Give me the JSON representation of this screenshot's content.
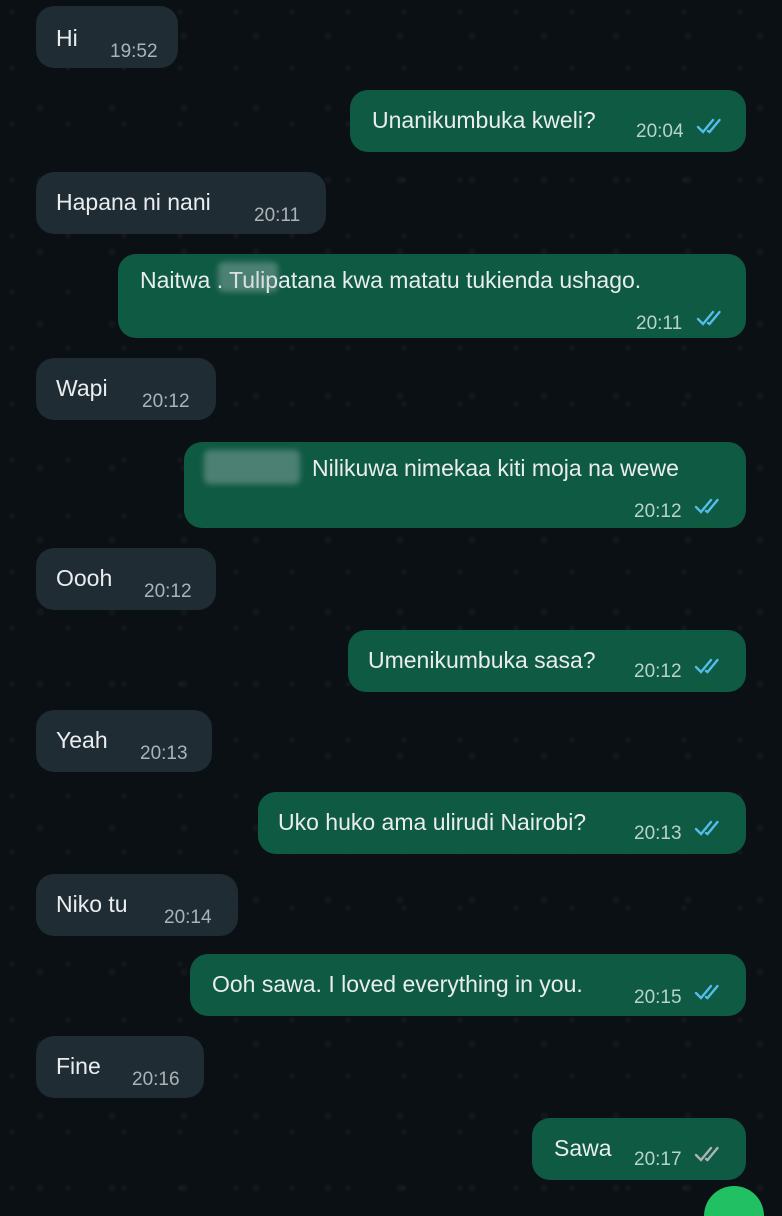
{
  "messages": [
    {
      "dir": "in",
      "text": "Hi",
      "time": "19:52"
    },
    {
      "dir": "out",
      "text": "Unanikumbuka kweli?",
      "time": "20:04",
      "status": "read"
    },
    {
      "dir": "in",
      "text": "Hapana ni nani",
      "time": "20:11"
    },
    {
      "dir": "out",
      "text": "Naitwa      . Tulipatana kwa matatu tukienda ushago.",
      "time": "20:11",
      "status": "read"
    },
    {
      "dir": "in",
      "text": "Wapi",
      "time": "20:12"
    },
    {
      "dir": "out",
      "text": "Nilikuwa nimekaa kiti moja na wewe",
      "time": "20:12",
      "status": "read"
    },
    {
      "dir": "in",
      "text": "Oooh",
      "time": "20:12"
    },
    {
      "dir": "out",
      "text": "Umenikumbuka sasa?",
      "time": "20:12",
      "status": "read"
    },
    {
      "dir": "in",
      "text": "Yeah",
      "time": "20:13"
    },
    {
      "dir": "out",
      "text": "Uko huko ama ulirudi Nairobi?",
      "time": "20:13",
      "status": "read"
    },
    {
      "dir": "in",
      "text": "Niko tu",
      "time": "20:14"
    },
    {
      "dir": "out",
      "text": "Ooh sawa. I loved everything in you.",
      "time": "20:15",
      "status": "read"
    },
    {
      "dir": "in",
      "text": "Fine",
      "time": "20:16"
    },
    {
      "dir": "out",
      "text": "Sawa",
      "time": "20:17",
      "status": "delivered"
    }
  ],
  "colors": {
    "incoming_bubble": "#202c33",
    "outgoing_bubble": "#0f5a43",
    "read_ticks": "#53bdeb",
    "delivered_ticks": "#aab3b8"
  },
  "icons": {
    "read": "double-check-blue-icon",
    "delivered": "double-check-grey-icon"
  }
}
